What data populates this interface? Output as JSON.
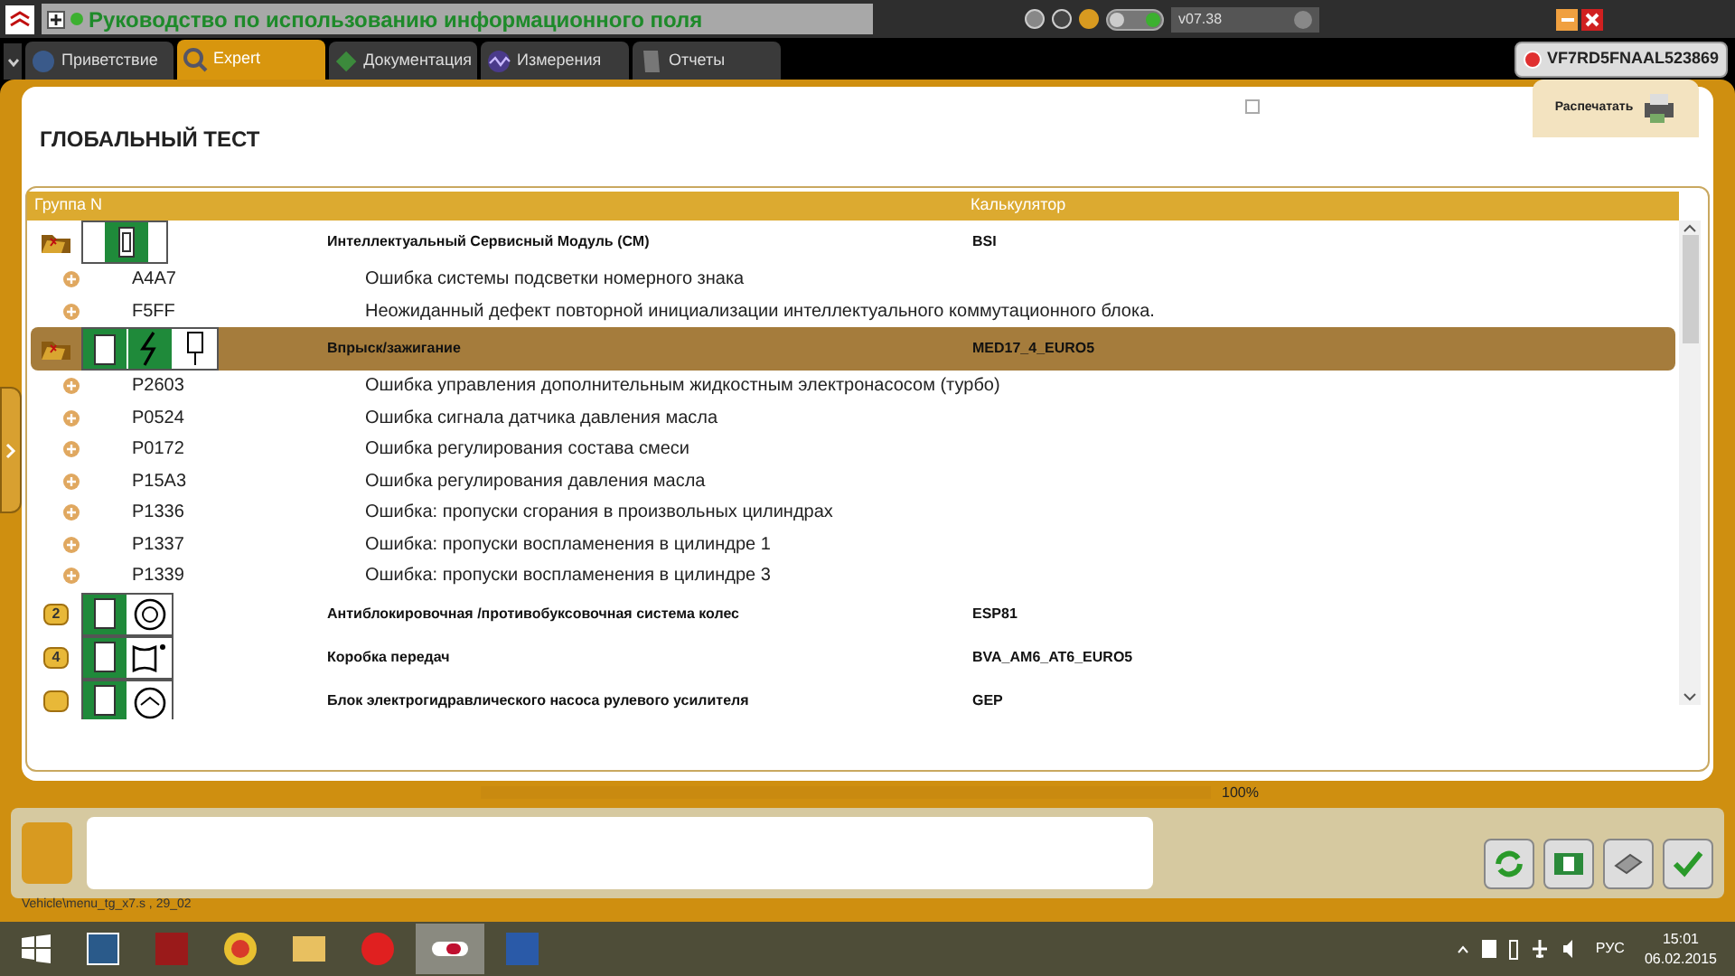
{
  "window": {
    "title": "Руководство по использованию информационного поля",
    "version": "v07.38"
  },
  "tabs": [
    {
      "label": "Приветствие",
      "selected": false
    },
    {
      "label": "Expert",
      "selected": true
    },
    {
      "label": "Документация",
      "selected": false
    },
    {
      "label": "Измерения",
      "selected": false
    },
    {
      "label": "Отчеты",
      "selected": false
    }
  ],
  "vin": "VF7RD5FNAAL523869",
  "page": {
    "title": "ГЛОБАЛЬНЫЙ ТЕСТ",
    "print_label": "Распечатать"
  },
  "table": {
    "columns": [
      "Группа N",
      "Калькулятор"
    ],
    "groups": [
      {
        "name": "Интеллектуальный Сервисный Модуль (СМ)",
        "calculator": "BSI",
        "expanded": true,
        "selected": false,
        "faults": [
          {
            "code": "A4A7",
            "description": "Ошибка системы подсветки номерного знака"
          },
          {
            "code": "F5FF",
            "description": "Неожиданный дефект повторной инициализации интеллектуального коммутационного блока."
          }
        ]
      },
      {
        "name": "Впрыск/зажигание",
        "calculator": "MED17_4_EURO5",
        "expanded": true,
        "selected": true,
        "faults": [
          {
            "code": "P2603",
            "description": "Ошибка управления дополнительным жидкостным электронасосом (турбо)"
          },
          {
            "code": "P0524",
            "description": "Ошибка сигнала датчика давления масла"
          },
          {
            "code": "P0172",
            "description": "Ошибка регулирования состава смеси"
          },
          {
            "code": "P15A3",
            "description": "Ошибка регулирования давления масла"
          },
          {
            "code": "P1336",
            "description": "Ошибка: пропуски сгорания в произвольных цилиндрах"
          },
          {
            "code": "P1337",
            "description": "Ошибка: пропуски воспламенения в цилиндре 1"
          },
          {
            "code": "P1339",
            "description": "Ошибка: пропуски воспламенения в цилиндре 3"
          }
        ]
      },
      {
        "name": "Антиблокировочная /противобуксовочная система колес",
        "calculator": "ESP81",
        "expanded": false,
        "selected": false,
        "badge": "2"
      },
      {
        "name": "Коробка передач",
        "calculator": "BVA_AM6_AT6_EURO5",
        "expanded": false,
        "selected": false,
        "badge": "4"
      },
      {
        "name": "Блок электрогидравлического насоса рулевого усилителя",
        "calculator": "GEP",
        "expanded": false,
        "selected": false
      }
    ]
  },
  "progress": {
    "level": 1.0,
    "reading": "100%"
  },
  "status_path": "Vehicle\\menu_tg_x7.s , 29_02",
  "taskbar": {
    "language": "РУС",
    "time": "15:01",
    "date": "06.02.2015"
  }
}
